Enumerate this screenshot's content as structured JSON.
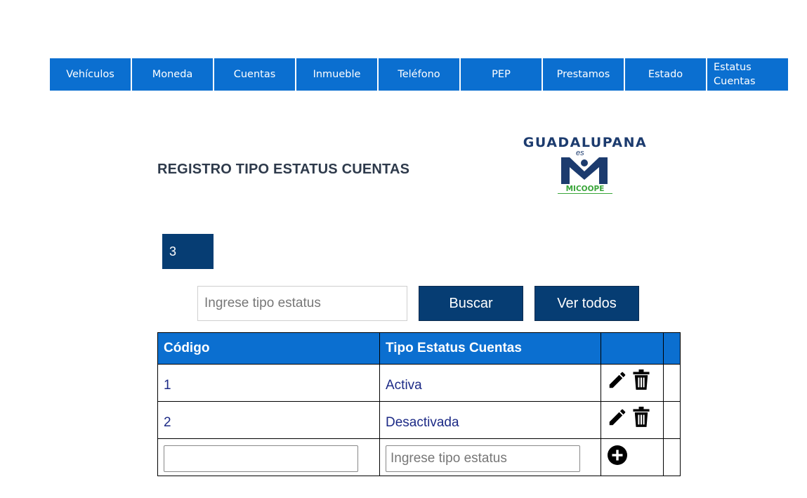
{
  "nav": {
    "items": [
      "Vehículos",
      "Moneda",
      "Cuentas",
      "Inmueble",
      "Teléfono",
      "PEP",
      "Prestamos",
      "Estado"
    ],
    "last_line1": "Estatus",
    "last_line2": "Cuentas"
  },
  "page": {
    "title": "REGISTRO TIPO ESTATUS CUENTAS"
  },
  "logo": {
    "name": "GUADALUPANA",
    "es": "es",
    "sub": "MICOOPE",
    "colors": {
      "blue": "#1c3b6e",
      "green": "#3aa63a"
    }
  },
  "counter": {
    "value": "3"
  },
  "search": {
    "placeholder": "Ingrese tipo estatus",
    "value": "",
    "buscar_label": "Buscar",
    "ver_todos_label": "Ver todos"
  },
  "table": {
    "headers": {
      "codigo": "Código",
      "tipo": "Tipo Estatus Cuentas",
      "actions": "",
      "extra": ""
    },
    "rows": [
      {
        "codigo": "1",
        "tipo": "Activa"
      },
      {
        "codigo": "2",
        "tipo": "Desactivada"
      }
    ],
    "new_row": {
      "codigo_value": "",
      "tipo_placeholder": "Ingrese tipo estatus"
    },
    "icons": {
      "edit": "pencil-icon",
      "delete": "trash-icon",
      "add": "plus-circle-icon"
    }
  },
  "colors": {
    "nav_bg": "#0b6fd0",
    "header_bg": "#0b6fd0",
    "button_bg": "#063d73",
    "cell_text": "#1c2a86"
  }
}
